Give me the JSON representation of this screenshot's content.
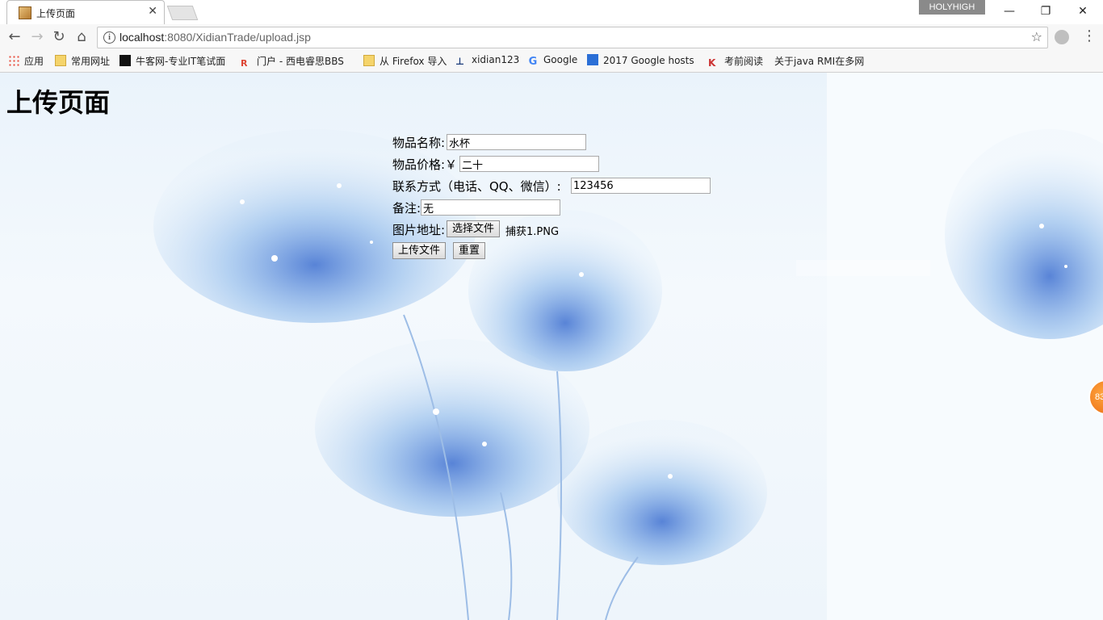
{
  "browser": {
    "tab_title": "上传页面",
    "tab_close": "✕",
    "profile_name": "HOLYHIGH",
    "window_controls": {
      "minimize": "—",
      "restore": "❐",
      "close": "✕"
    },
    "url_host": "localhost",
    "url_rest": ":8080/XidianTrade/upload.jsp",
    "nav": {
      "back": "←",
      "forward": "→",
      "reload": "↻",
      "home": "⌂"
    },
    "star": "☆",
    "menu": "⋮"
  },
  "bookmarks": [
    {
      "label": "应用",
      "icon": "apps-icon"
    },
    {
      "label": "常用网址",
      "icon": "folder-icon"
    },
    {
      "label": "牛客网-专业IT笔试面",
      "icon": "nowcoder-icon"
    },
    {
      "label": "门户 - 西电睿思BBS",
      "icon": "rs-icon"
    },
    {
      "label": "从 Firefox 导入",
      "icon": "folder-icon"
    },
    {
      "label": "xidian123",
      "icon": "xidian-icon"
    },
    {
      "label": "Google",
      "icon": "google-icon"
    },
    {
      "label": "2017 Google hosts",
      "icon": "hosts-icon"
    },
    {
      "label": "考前阅读",
      "icon": "reading-icon"
    },
    {
      "label": "关于java RMI在多网",
      "icon": "page-icon"
    }
  ],
  "page": {
    "title": "上传页面",
    "form": {
      "name_label": "物品名称:",
      "name_value": "水杯",
      "price_label": "物品价格:￥",
      "price_value": "二十",
      "contact_label": "联系方式（电话、QQ、微信）:",
      "contact_value": "123456",
      "note_label": "备注:",
      "note_value": "无",
      "image_label": "图片地址:",
      "choose_file_button": "选择文件",
      "chosen_file": "捕获1.PNG",
      "submit_button": "上传文件",
      "reset_button": "重置"
    },
    "badge_text": "83"
  },
  "colors": {
    "page_background": "#eaf3fb",
    "badge_orange": "#ea6a10"
  }
}
